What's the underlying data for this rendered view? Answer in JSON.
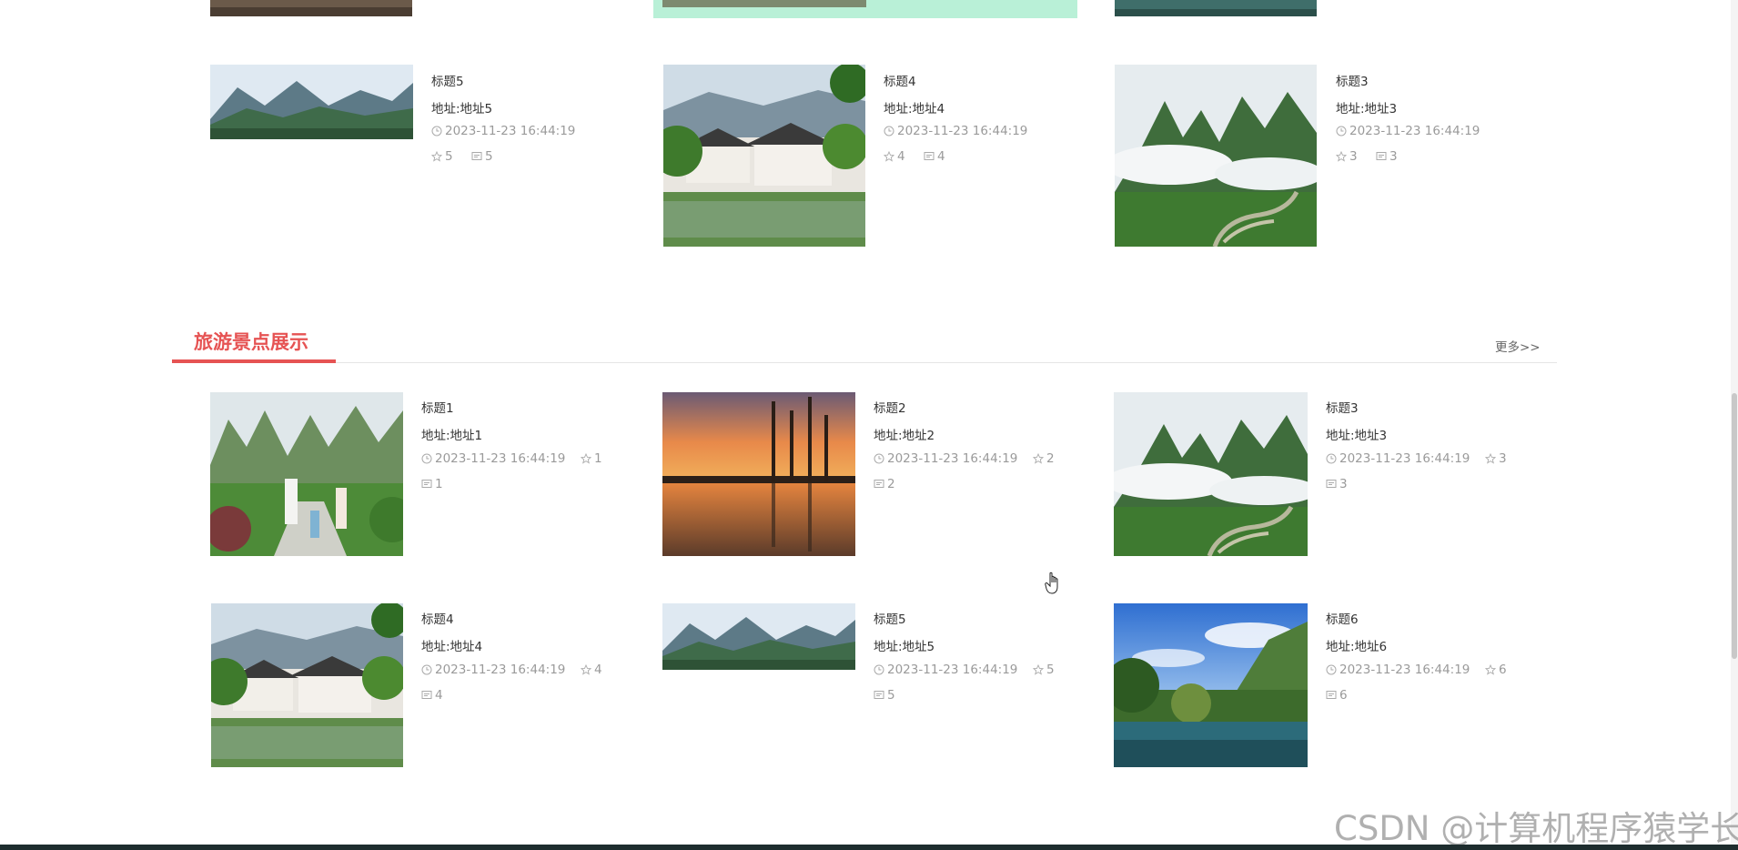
{
  "section": {
    "title": "旅游景点展示",
    "more": "更多>>"
  },
  "top_cards": [
    {
      "title": "标题5",
      "address": "地址:地址5",
      "date": "2023-11-23 16:44:19",
      "likes": "5",
      "comments": "5"
    },
    {
      "title": "标题4",
      "address": "地址:地址4",
      "date": "2023-11-23 16:44:19",
      "likes": "4",
      "comments": "4"
    },
    {
      "title": "标题3",
      "address": "地址:地址3",
      "date": "2023-11-23 16:44:19",
      "likes": "3",
      "comments": "3"
    }
  ],
  "grid_cards": [
    {
      "title": "标题1",
      "address": "地址:地址1",
      "date": "2023-11-23 16:44:19",
      "likes": "1",
      "comments": "1"
    },
    {
      "title": "标题2",
      "address": "地址:地址2",
      "date": "2023-11-23 16:44:19",
      "likes": "2",
      "comments": "2"
    },
    {
      "title": "标题3",
      "address": "地址:地址3",
      "date": "2023-11-23 16:44:19",
      "likes": "3",
      "comments": "3"
    },
    {
      "title": "标题4",
      "address": "地址:地址4",
      "date": "2023-11-23 16:44:19",
      "likes": "4",
      "comments": "4"
    },
    {
      "title": "标题5",
      "address": "地址:地址5",
      "date": "2023-11-23 16:44:19",
      "likes": "5",
      "comments": "5"
    },
    {
      "title": "标题6",
      "address": "地址:地址6",
      "date": "2023-11-23 16:44:19",
      "likes": "6",
      "comments": "6"
    }
  ],
  "watermark": "CSDN @计算机程序猿学长",
  "colors": {
    "accent": "#e65353",
    "meta": "#9a9a9a",
    "text": "#333333"
  },
  "icons": {
    "date": "clock-icon",
    "likes": "star-icon",
    "comments": "comment-icon"
  }
}
